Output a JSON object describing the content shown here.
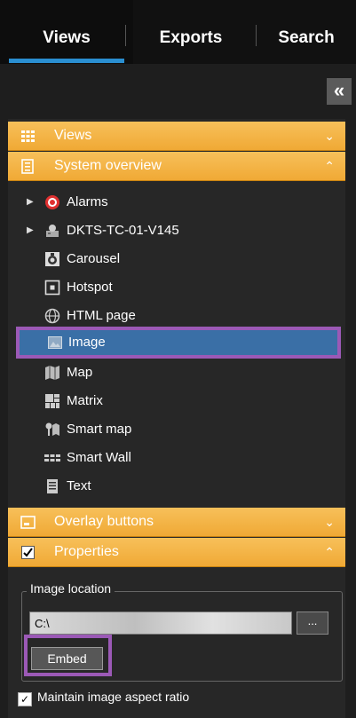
{
  "tabs": [
    {
      "label": "Views",
      "active": true
    },
    {
      "label": "Exports",
      "active": false
    },
    {
      "label": "Search",
      "active": false
    }
  ],
  "collapse_button": {
    "glyph": "«"
  },
  "sections": {
    "views": {
      "label": "Views",
      "chevron": "⌄"
    },
    "system_overview": {
      "label": "System overview",
      "chevron": "⌃"
    },
    "overlay_buttons": {
      "label": "Overlay buttons",
      "chevron": "⌄"
    },
    "properties": {
      "label": "Properties",
      "chevron": "⌃"
    }
  },
  "tree": [
    {
      "label": "Alarms",
      "icon": "alarm-icon",
      "expandable": true
    },
    {
      "label": "DKTS-TC-01-V145",
      "icon": "server-icon",
      "expandable": true
    },
    {
      "label": "Carousel",
      "icon": "carousel-icon",
      "expandable": false
    },
    {
      "label": "Hotspot",
      "icon": "hotspot-icon",
      "expandable": false
    },
    {
      "label": "HTML page",
      "icon": "globe-icon",
      "expandable": false
    },
    {
      "label": "Image",
      "icon": "image-icon",
      "expandable": false,
      "selected": true
    },
    {
      "label": "Map",
      "icon": "map-icon",
      "expandable": false
    },
    {
      "label": "Matrix",
      "icon": "matrix-icon",
      "expandable": false
    },
    {
      "label": "Smart map",
      "icon": "smart-map-icon",
      "expandable": false
    },
    {
      "label": "Smart Wall",
      "icon": "smart-wall-icon",
      "expandable": false
    },
    {
      "label": "Text",
      "icon": "text-icon",
      "expandable": false
    }
  ],
  "properties": {
    "image_location_label": "Image location",
    "path_value": "C:\\",
    "browse_label": "...",
    "embed_label": "Embed",
    "maintain_aspect_label": "Maintain image aspect ratio",
    "maintain_aspect_checked": true,
    "checkbox_glyph": "✓"
  },
  "colors": {
    "accent_blue": "#2a8fd1",
    "header_orange": "#f0a935",
    "highlight_purple": "#9b59b6",
    "selected_row": "#3a6fa6"
  }
}
